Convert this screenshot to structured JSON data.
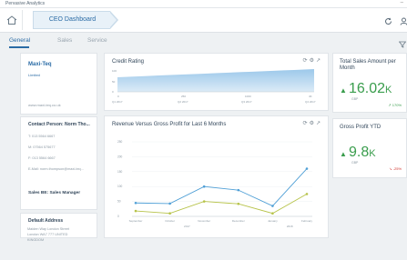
{
  "app": {
    "title": "Pervasive Analytics",
    "window_controls": "–"
  },
  "header": {
    "breadcrumb": "CEO Dashboard"
  },
  "tabs": [
    {
      "label": "General"
    },
    {
      "label": "Sales"
    },
    {
      "label": "Service"
    }
  ],
  "company": {
    "name": "Maxi-Teq",
    "subtitle": "Limited",
    "url": "www.maxi-teq.co.uk"
  },
  "contact": {
    "title": "Contact Person: Norm Tho...",
    "lines": [
      "T: 013 5564 6667",
      "M: 07564 575677",
      "F: 013 5564 6667",
      "E-Mail: norm.thompson@maxi-teq..."
    ],
    "sales_rep": "Sales BE: Sales Manager"
  },
  "address": {
    "title": "Default Address",
    "lines": [
      "Maiden Way London Street",
      "London WA7 777 UNITED",
      "KINGDOM"
    ]
  },
  "credit": {
    "title": "Credit Rating",
    "x_ticks": [
      "Q1 2017",
      "Q2 2017",
      "Q3 2017",
      "Q4 2017"
    ],
    "top_ticks": [
      "0",
      "250",
      "1000",
      "4K"
    ],
    "y_ticks": [
      "100",
      "50",
      "0"
    ]
  },
  "total_sales": {
    "title": "Total Sales Amount per Month",
    "value": "16.02",
    "unit_suffix": "K",
    "currency": "GBP",
    "delta": "170%",
    "color": "#3a9d4d"
  },
  "gross_profit": {
    "title": "Gross Profit YTD",
    "value": "9.8",
    "unit_suffix": "K",
    "currency": "GBP",
    "delta": "-25%",
    "delta_color": "#d0342c"
  },
  "chart_data": {
    "type": "line",
    "title": "Revenue Versus Gross Profit for Last 6 Months",
    "categories": [
      "September",
      "October",
      "November",
      "December",
      "January",
      "February"
    ],
    "year_labels": [
      "2017",
      "2018"
    ],
    "y_ticks": [
      "250",
      "200",
      "150",
      "100",
      "50",
      "0"
    ],
    "ylim": [
      0,
      250
    ],
    "series": [
      {
        "values": [
          45,
          43,
          100,
          88,
          35,
          160
        ],
        "color": "#4f9fd6"
      },
      {
        "values": [
          18,
          10,
          50,
          42,
          10,
          75
        ],
        "color": "#b7c34a"
      }
    ]
  }
}
